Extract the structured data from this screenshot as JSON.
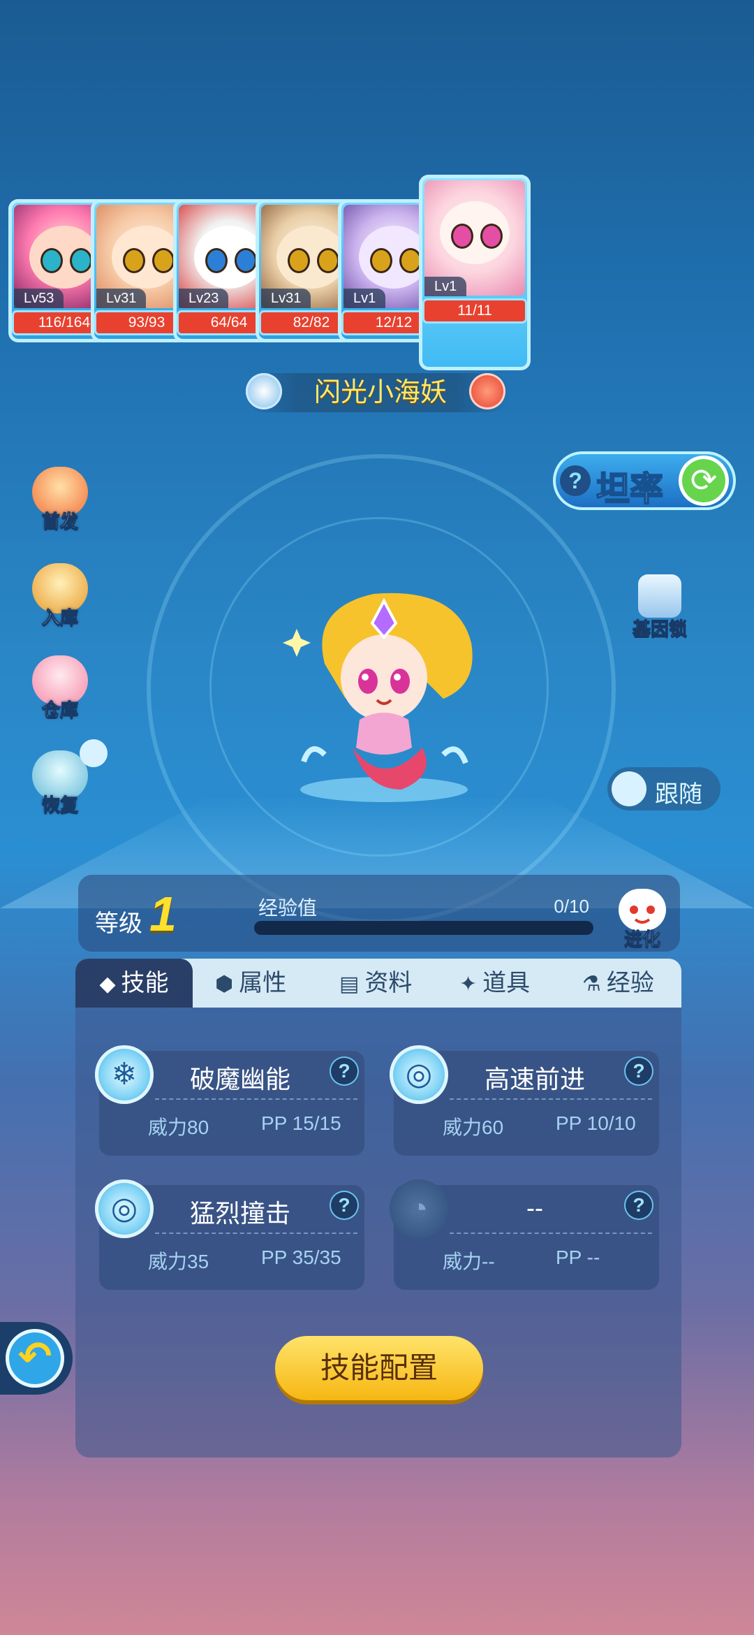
{
  "team": [
    {
      "level": "Lv53",
      "hp": "116/164",
      "portrait": "pink-haired-girl",
      "selected": false
    },
    {
      "level": "Lv31",
      "hp": "93/93",
      "portrait": "fox-cub",
      "selected": false
    },
    {
      "level": "Lv23",
      "hp": "64/64",
      "portrait": "red-fox-masked",
      "selected": false
    },
    {
      "level": "Lv31",
      "hp": "82/82",
      "portrait": "deer-cub",
      "selected": false
    },
    {
      "level": "Lv1",
      "hp": "12/12",
      "portrait": "purple-cat",
      "selected": false
    },
    {
      "level": "Lv1",
      "hp": "11/11",
      "portrait": "mermaid-girl",
      "selected": true
    }
  ],
  "pet": {
    "name": "闪光小海妖",
    "element_icon": "water-element-icon",
    "gender_icon": "pet-badge-icon"
  },
  "left_menu": [
    {
      "label": "首发",
      "icon": "first-start-icon"
    },
    {
      "label": "入库",
      "icon": "storage-in-icon"
    },
    {
      "label": "仓库",
      "icon": "warehouse-icon"
    },
    {
      "label": "恢复",
      "icon": "heal-icon"
    }
  ],
  "temperament": {
    "label": "坦率",
    "help": "?"
  },
  "gene_lock": {
    "label": "基因锁"
  },
  "follow": {
    "label": "跟随"
  },
  "level": {
    "label": "等级",
    "value": "1",
    "exp_label": "经验值",
    "exp_value": "0/10",
    "exp_progress": 0.0
  },
  "evolve": {
    "label": "进化"
  },
  "tabs": [
    {
      "label": "技能",
      "icon": "diamond-icon",
      "active": true
    },
    {
      "label": "属性",
      "icon": "hexagon-icon",
      "active": false
    },
    {
      "label": "资料",
      "icon": "clipboard-icon",
      "active": false
    },
    {
      "label": "道具",
      "icon": "star-item-icon",
      "active": false
    },
    {
      "label": "经验",
      "icon": "flask-icon",
      "active": false
    }
  ],
  "skills": [
    {
      "name": "破魔幽能",
      "power": "威力80",
      "pp": "PP 15/15",
      "help": "?",
      "icon": "snowflake-icon"
    },
    {
      "name": "高速前进",
      "power": "威力60",
      "pp": "PP 10/10",
      "help": "?",
      "icon": "target-icon"
    },
    {
      "name": "猛烈撞击",
      "power": "威力35",
      "pp": "PP 35/35",
      "help": "?",
      "icon": "target-icon"
    },
    {
      "name": "--",
      "power": "威力--",
      "pp": "PP --",
      "help": "?",
      "icon": "locked-skill-icon"
    }
  ],
  "config_button": "技能配置",
  "colors": {
    "accent_yellow": "#ffe02e",
    "hp_red": "#e8412f",
    "panel_blue": "#2a3f67"
  }
}
